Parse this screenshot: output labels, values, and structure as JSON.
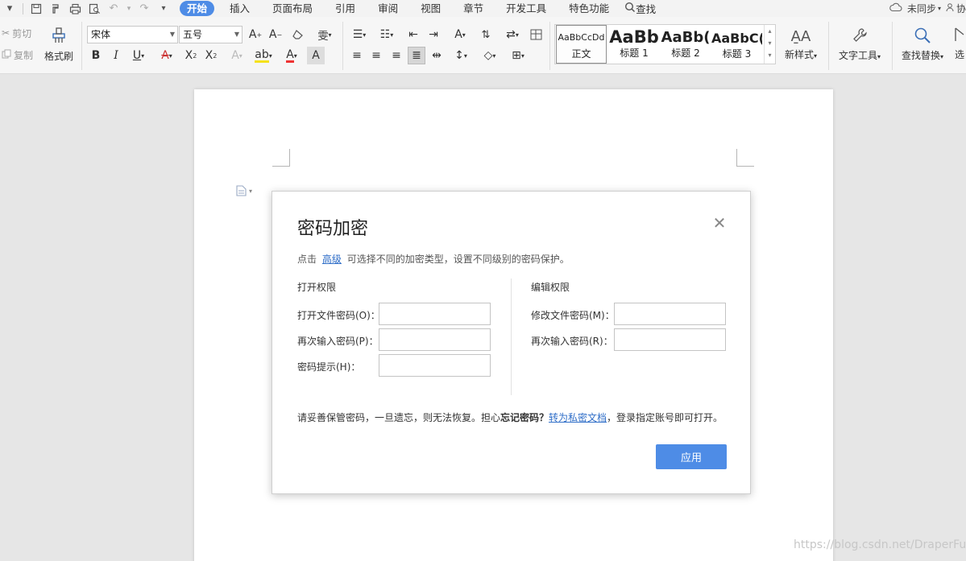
{
  "menubar": {
    "tabs": [
      "开始",
      "插入",
      "页面布局",
      "引用",
      "审阅",
      "视图",
      "章节",
      "开发工具",
      "特色功能"
    ],
    "search": "查找",
    "sync_status": "未同步",
    "partial_right": "协"
  },
  "ribbon": {
    "cut": "剪切",
    "copy": "复制",
    "format_painter": "格式刷",
    "font_name": "宋体",
    "font_size": "五号",
    "styles": [
      {
        "sample": "AaBbCcDd",
        "label": "正文"
      },
      {
        "sample": "AaBb",
        "label": "标题 1"
      },
      {
        "sample": "AaBb(",
        "label": "标题 2"
      },
      {
        "sample": "AaBbC(",
        "label": "标题 3"
      }
    ],
    "new_style": "新样式",
    "text_tools": "文字工具",
    "find_replace": "查找替换",
    "select": "选"
  },
  "dialog": {
    "title": "密码加密",
    "hint_prefix": "点击",
    "hint_link": "高级",
    "hint_suffix": "可选择不同的加密类型，设置不同级别的密码保护。",
    "open_section": "打开权限",
    "open_password_label": "打开文件密码(O)：",
    "open_confirm_label": "再次输入密码(P)：",
    "password_hint_label": "密码提示(H)：",
    "edit_section": "编辑权限",
    "edit_password_label": "修改文件密码(M)：",
    "edit_confirm_label": "再次输入密码(R)：",
    "note_prefix": "请妥善保管密码，一旦遗忘，则无法恢复。担心",
    "note_bold": "忘记密码？",
    "note_link": "转为私密文档",
    "note_suffix": "，登录指定账号即可打开。",
    "apply": "应用"
  },
  "watermark": "https://blog.csdn.net/DraperFu"
}
